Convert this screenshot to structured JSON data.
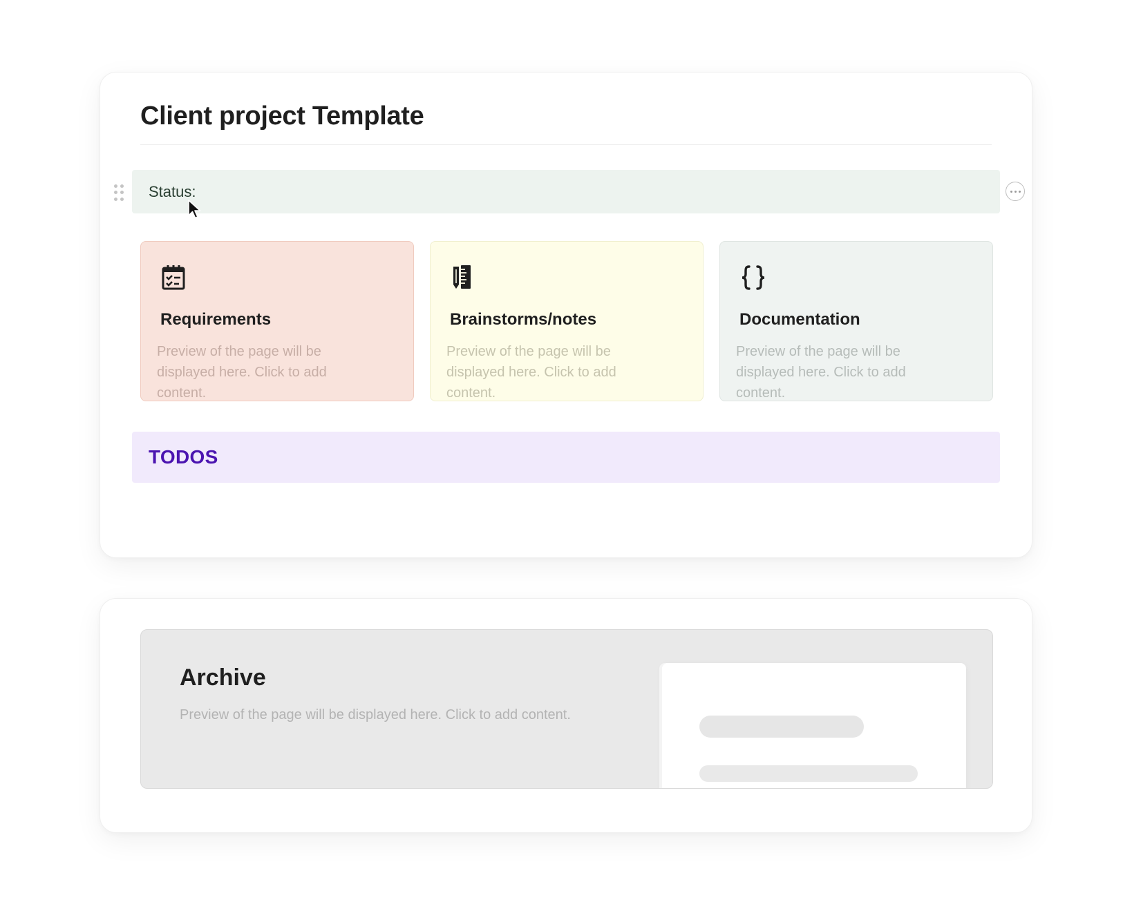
{
  "page": {
    "title": "Client project Template"
  },
  "status": {
    "label": "Status:"
  },
  "cards": [
    {
      "title": "Requirements",
      "icon": "checklist-calendar-icon",
      "preview": "Preview of the page will be displayed here. Click to add content.",
      "color": "#f9e3dc"
    },
    {
      "title": "Brainstorms/notes",
      "icon": "pencil-ruler-icon",
      "preview": "Preview of the page will be displayed here. Click to add content.",
      "color": "#fefde8"
    },
    {
      "title": "Documentation",
      "icon": "curly-braces-icon",
      "preview": "Preview of the page will be displayed here. Click to add content.",
      "color": "#eff3f1"
    }
  ],
  "todos": {
    "label": "TODOS",
    "color": "#4b14b0"
  },
  "archive": {
    "title": "Archive",
    "preview": "Preview of the page will be displayed here. Click to add content."
  }
}
